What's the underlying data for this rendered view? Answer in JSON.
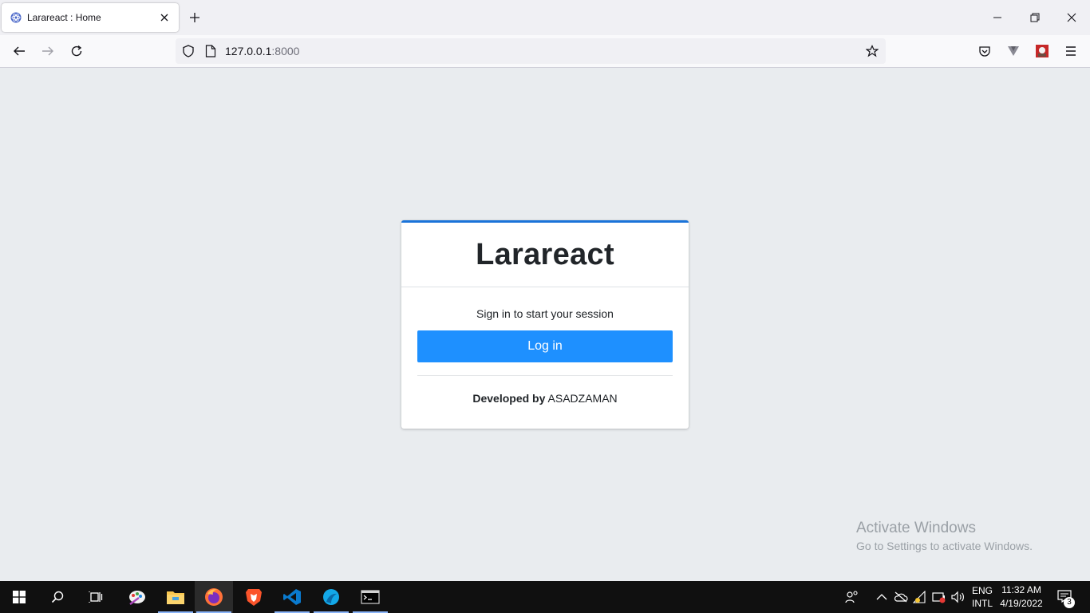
{
  "browser": {
    "tab": {
      "title": "Larareact : Home"
    },
    "url": {
      "host": "127.0.0.1",
      "port": ":8000"
    }
  },
  "page": {
    "brand": "Larareact",
    "message": "Sign in to start your session",
    "login_button": "Log in",
    "credit": {
      "label": "Developed by",
      "name": "ASADZAMAN"
    }
  },
  "watermark": {
    "title": "Activate Windows",
    "subtitle": "Go to Settings to activate Windows."
  },
  "taskbar": {
    "lang_top": "ENG",
    "lang_bottom": "INTL",
    "time": "11:32 AM",
    "date": "4/19/2022",
    "notification_count": "3"
  },
  "colors": {
    "accent": "#1e90ff",
    "card_top_border": "#1a73d9",
    "page_background": "#e9ecef"
  }
}
